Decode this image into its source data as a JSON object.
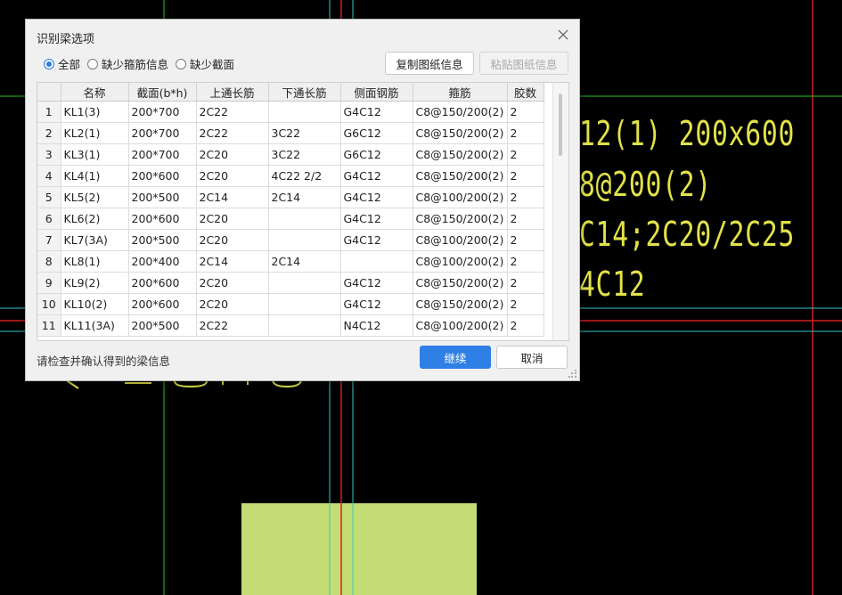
{
  "cad": {
    "line_color_cyan": "#35c9c9",
    "line_color_red": "#d22020",
    "line_color_green": "#22c422",
    "text_color": "#e2e24a",
    "block_color": "#c4dc74",
    "texts": [
      "12(1) 200x600",
      "8@200(2)",
      "C14;2C20/2C25",
      "4C12"
    ]
  },
  "dialog": {
    "title": "识别梁选项",
    "radios": [
      {
        "label": "全部",
        "selected": true
      },
      {
        "label": "缺少箍筋信息",
        "selected": false
      },
      {
        "label": "缺少截面",
        "selected": false
      }
    ],
    "copy_button": "复制图纸信息",
    "paste_button": "粘贴图纸信息",
    "table": {
      "headers": [
        "",
        "名称",
        "截面(b*h)",
        "上通长筋",
        "下通长筋",
        "侧面钢筋",
        "箍筋",
        "胶数"
      ],
      "rows": [
        [
          "1",
          "KL1(3)",
          "200*700",
          "2C22",
          "",
          "G4C12",
          "C8@150/200(2)",
          "2"
        ],
        [
          "2",
          "KL2(1)",
          "200*700",
          "2C22",
          "3C22",
          "G6C12",
          "C8@150/200(2)",
          "2"
        ],
        [
          "3",
          "KL3(1)",
          "200*700",
          "2C20",
          "3C22",
          "G6C12",
          "C8@150/200(2)",
          "2"
        ],
        [
          "4",
          "KL4(1)",
          "200*600",
          "2C20",
          "4C22 2/2",
          "G4C12",
          "C8@150/200(2)",
          "2"
        ],
        [
          "5",
          "KL5(2)",
          "200*500",
          "2C14",
          "2C14",
          "G4C12",
          "C8@100/200(2)",
          "2"
        ],
        [
          "6",
          "KL6(2)",
          "200*600",
          "2C20",
          "",
          "G4C12",
          "C8@150/200(2)",
          "2"
        ],
        [
          "7",
          "KL7(3A)",
          "200*500",
          "2C20",
          "",
          "G4C12",
          "C8@100/200(2)",
          "2"
        ],
        [
          "8",
          "KL8(1)",
          "200*400",
          "2C14",
          "2C14",
          "",
          "C8@100/200(2)",
          "2"
        ],
        [
          "9",
          "KL9(2)",
          "200*600",
          "2C20",
          "",
          "G4C12",
          "C8@150/200(2)",
          "2"
        ],
        [
          "10",
          "KL10(2)",
          "200*600",
          "2C20",
          "",
          "G4C12",
          "C8@150/200(2)",
          "2"
        ],
        [
          "11",
          "KL11(3A)",
          "200*500",
          "2C22",
          "",
          "N4C12",
          "C8@100/200(2)",
          "2"
        ]
      ]
    },
    "status_text": "请检查并确认得到的梁信息",
    "continue_button": "继续",
    "cancel_button": "取消"
  }
}
